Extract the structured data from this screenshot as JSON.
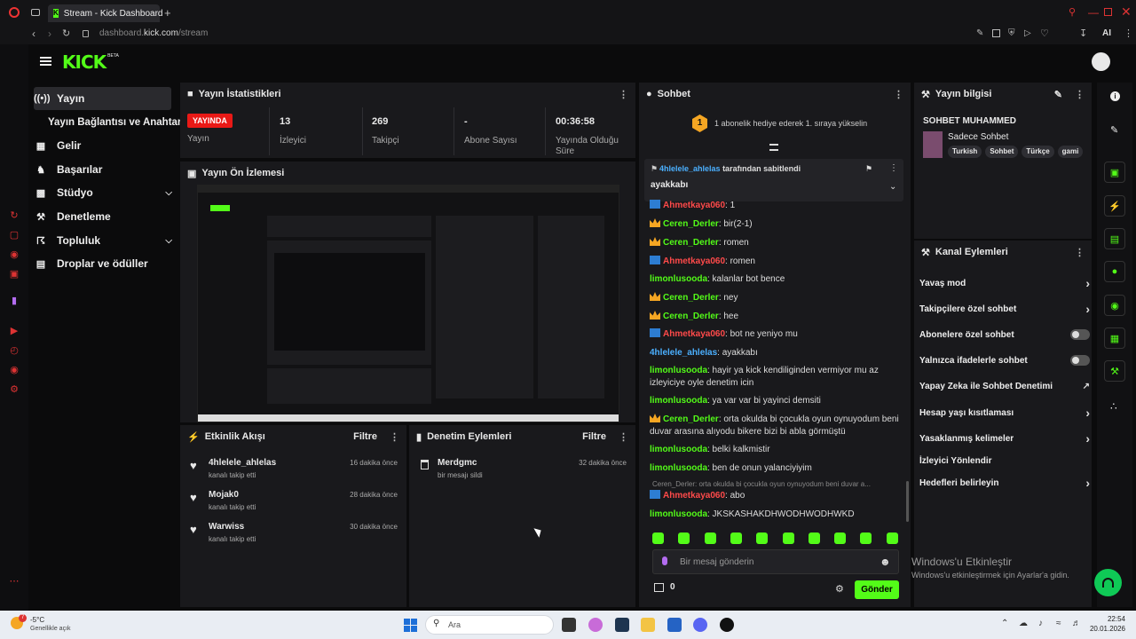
{
  "browser": {
    "tab_title": "Stream - Kick Dashboard",
    "url_host": "dashboard.",
    "url_domain": "kick.com",
    "url_path": "/stream",
    "ai_label": "AI"
  },
  "brand": {
    "logo": "KICK",
    "beta": "BETA"
  },
  "sidebar": {
    "items": [
      {
        "label": "Yayın",
        "icon": "broadcast-icon"
      },
      {
        "label": "Yayın Bağlantısı ve Anahtarı",
        "icon": ""
      },
      {
        "label": "Gelir",
        "icon": "chart-icon"
      },
      {
        "label": "Başarılar",
        "icon": "trophy-icon"
      },
      {
        "label": "Stüdyo",
        "icon": "studio-icon"
      },
      {
        "label": "Denetleme",
        "icon": "wrench-icon"
      },
      {
        "label": "Topluluk",
        "icon": "community-icon"
      },
      {
        "label": "Droplar ve ödüller",
        "icon": "gift-icon"
      }
    ]
  },
  "stats": {
    "title": "Yayın İstatistikleri",
    "live_badge": "YAYINDA",
    "live_label": "Yayın",
    "viewers_val": "13",
    "viewers_label": "İzleyici",
    "followers_val": "269",
    "followers_label": "Takipçi",
    "subs_val": "-",
    "subs_label": "Abone Sayısı",
    "uptime_val": "00:36:58",
    "uptime_label": "Yayında Olduğu Süre"
  },
  "preview": {
    "title": "Yayın Ön İzlemesi"
  },
  "activity": {
    "title": "Etkinlik Akışı",
    "filter": "Filtre",
    "items": [
      {
        "name": "4hlelele_ahlelas",
        "sub": "kanalı takip etti",
        "time": "16 dakika önce"
      },
      {
        "name": "Mojak0",
        "sub": "kanalı takip etti",
        "time": "28 dakika önce"
      },
      {
        "name": "Warwiss",
        "sub": "kanalı takip etti",
        "time": "30 dakika önce"
      }
    ]
  },
  "modlog": {
    "title": "Denetim Eylemleri",
    "filter": "Filtre",
    "items": [
      {
        "name": "Merdgmc",
        "sub": "bir mesajı sildi",
        "time": "32 dakika önce"
      }
    ]
  },
  "chat": {
    "title": "Sohbet",
    "gift_banner": "1 abonelik hediye ederek 1. sıraya yükselin",
    "gift_rank": "1",
    "pinned_by": "4hlelele_ahlelas",
    "pinned_suffix": "tarafından sabitlendi",
    "pinned_msg": "ayakkabı",
    "messages": [
      {
        "user": "Ahmetkaya060",
        "color": "red",
        "badge": "blue",
        "text": ": 1"
      },
      {
        "user": "Ceren_Derler",
        "color": "green",
        "badge": "crown",
        "text": ": bir(2-1)"
      },
      {
        "user": "Ceren_Derler",
        "color": "green",
        "badge": "crown",
        "text": ": romen"
      },
      {
        "user": "Ahmetkaya060",
        "color": "red",
        "badge": "blue",
        "text": ": romen"
      },
      {
        "user": "limonlusooda",
        "color": "green",
        "badge": "",
        "text": ": kalanlar bot bence"
      },
      {
        "user": "Ceren_Derler",
        "color": "green",
        "badge": "crown",
        "text": ": ney"
      },
      {
        "user": "Ceren_Derler",
        "color": "green",
        "badge": "crown",
        "text": ": hee"
      },
      {
        "user": "Ahmetkaya060",
        "color": "red",
        "badge": "blue",
        "text": ": bot ne yeniyo mu"
      },
      {
        "user": "4hlelele_ahlelas",
        "color": "blue",
        "badge": "",
        "text": ": ayakkabı"
      },
      {
        "user": "limonlusooda",
        "color": "green",
        "badge": "",
        "text": ": hayir ya kick kendiliginden vermiyor mu az izleyiciye oyle denetim icin"
      },
      {
        "user": "limonlusooda",
        "color": "green",
        "badge": "",
        "text": ": ya var var bi yayinci demsiti"
      },
      {
        "user": "Ceren_Derler",
        "color": "green",
        "badge": "crown",
        "text": ": orta okulda bi çocukla oyun oynuyodum beni duvar arasına alıyodu bikere bizi bi abla görmüştü"
      },
      {
        "user": "limonlusooda",
        "color": "green",
        "badge": "",
        "text": ": belki kalkmistir"
      },
      {
        "user": "limonlusooda",
        "color": "green",
        "badge": "",
        "text": ": ben de onun yalanciyiyim"
      },
      {
        "user": "Ahmetkaya060",
        "color": "red",
        "badge": "blue",
        "text": ": abo"
      },
      {
        "user": "limonlusooda",
        "color": "green",
        "badge": "",
        "text": ": JKSKASHAKDHWODHWODHWKD"
      }
    ],
    "reply_preview": "Ceren_Derler: orta okulda bi çocukla oyun oynuyodum beni duvar a...",
    "input_placeholder": "Bir mesaj gönderin",
    "points": "0",
    "send": "Gönder"
  },
  "info": {
    "title": "Yayın bilgisi",
    "stream_title": "SOHBET MUHAMMED",
    "category": "Sadece Sohbet",
    "tags": [
      "Turkish",
      "Sohbet",
      "Türkçe",
      "gami"
    ]
  },
  "actions": {
    "title": "Kanal Eylemleri",
    "items": [
      {
        "label": "Yavaş mod",
        "ctrl": "chev"
      },
      {
        "label": "Takipçilere özel sohbet",
        "ctrl": "chev"
      },
      {
        "label": "Abonelere özel sohbet",
        "ctrl": "toggle"
      },
      {
        "label": "Yalnızca ifadelerle sohbet",
        "ctrl": "toggle"
      },
      {
        "label": "Yapay Zeka ile Sohbet Denetimi",
        "ctrl": "ext"
      },
      {
        "label": "Hesap yaşı kısıtlaması",
        "ctrl": "chev"
      },
      {
        "label": "Yasaklanmış kelimeler",
        "ctrl": "chev"
      },
      {
        "label": "İzleyici Yönlendir",
        "ctrl": ""
      },
      {
        "label": "Hedefleri belirleyin",
        "ctrl": "chev"
      }
    ]
  },
  "watermark": {
    "line1": "Windows'u Etkinleştir",
    "line2": "Windows'u etkinleştirmek için Ayarlar'a gidin."
  },
  "taskbar": {
    "weather_temp": "-5°C",
    "weather_desc": "Genellikle açık",
    "search": "Ara",
    "time": "22:54",
    "date": "20.01.2026",
    "badge": "7"
  },
  "colors": {
    "accent": "#53fc18",
    "live": "#e91916",
    "panel": "#19191c"
  }
}
